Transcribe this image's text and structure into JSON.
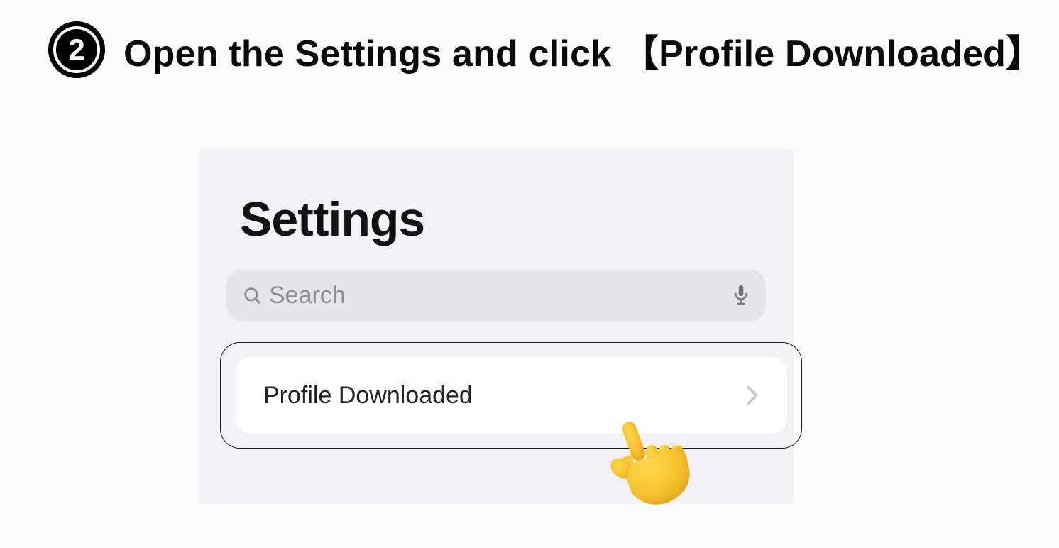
{
  "step": {
    "number": "2",
    "instruction": "Open the Settings and click 【Profile Downloaded】"
  },
  "panel": {
    "title": "Settings",
    "search_placeholder": "Search",
    "cell_label": "Profile Downloaded"
  }
}
